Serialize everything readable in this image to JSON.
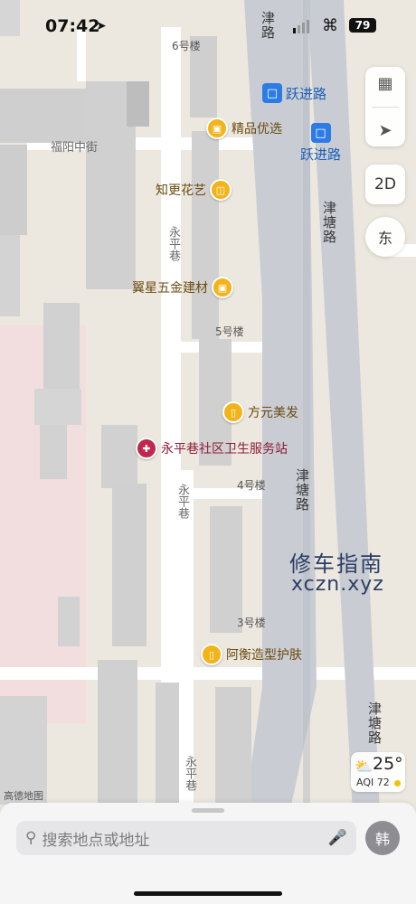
{
  "status_bar": {
    "time": "07:42",
    "battery": "79"
  },
  "map": {
    "provider_logo": "高德地图",
    "road_labels": {
      "fuyang": "福阳中街",
      "yongping_1": "永平巷",
      "yongping_2": "永平巷",
      "yongping_3": "永平巷",
      "jintang_1": "津塘路",
      "jintang_2": "津塘路",
      "jintang_3": "津塘路",
      "upper_road": "津路"
    },
    "building_labels": {
      "b6": "6号楼",
      "b5": "5号楼",
      "b4": "4号楼",
      "b3": "3号楼"
    },
    "bus_stops": [
      {
        "label": "跃进路",
        "icon": "bus-icon"
      },
      {
        "label": "跃进路",
        "icon": "bus-icon"
      }
    ],
    "pois": {
      "jingpin": "精品优选",
      "zhigeng": "知更花艺",
      "yixing": "翼星五金建材",
      "fangyuan": "方元美发",
      "clinic": "永平巷社区卫生服务站",
      "aheng": "阿衡造型护肤"
    },
    "colors": {
      "main_road": "#c9ccd3",
      "poi_yellow": "#f3b41b",
      "bus_blue": "#2d7be5",
      "clinic_red": "#c2274b"
    }
  },
  "controls": {
    "map_mode": "map-icon",
    "locate": "location-arrow-icon",
    "view_mode": "2D",
    "compass": "东"
  },
  "watermark": {
    "cn": "修车指南",
    "en": "xczn.xyz"
  },
  "weather": {
    "temperature": "25°",
    "aqi": "AQI 72"
  },
  "bottom_sheet": {
    "search_placeholder": "搜索地点或地址",
    "avatar": "韩"
  }
}
